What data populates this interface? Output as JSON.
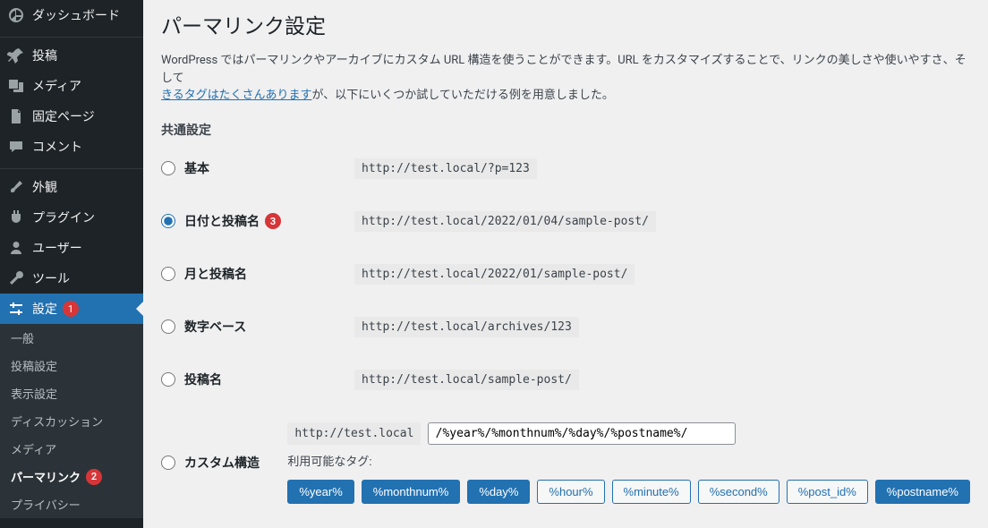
{
  "sidebar": {
    "dashboard": "ダッシュボード",
    "posts": "投稿",
    "media": "メディア",
    "pages": "固定ページ",
    "comments": "コメント",
    "appearance": "外観",
    "plugins": "プラグイン",
    "users": "ユーザー",
    "tools": "ツール",
    "settings": "設定",
    "settings_badge": "1",
    "sub": {
      "general": "一般",
      "writing": "投稿設定",
      "reading": "表示設定",
      "discussion": "ディスカッション",
      "media_s": "メディア",
      "permalinks": "パーマリンク",
      "permalinks_badge": "2",
      "privacy": "プライバシー"
    }
  },
  "page": {
    "title": "パーマリンク設定",
    "intro_1": "WordPress ではパーマリンクやアーカイブにカスタム URL 構造を使うことができます。URL をカスタマイズすることで、リンクの美しさや使いやすさ、そして",
    "intro_link": "きるタグはたくさんあります",
    "intro_2": "が、以下にいくつか試していただける例を用意しました。",
    "section": "共通設定"
  },
  "options": {
    "plain": {
      "label": "基本",
      "example": "http://test.local/?p=123"
    },
    "date_name": {
      "label": "日付と投稿名",
      "example": "http://test.local/2022/01/04/sample-post/",
      "badge": "3"
    },
    "month_name": {
      "label": "月と投稿名",
      "example": "http://test.local/2022/01/sample-post/"
    },
    "numeric": {
      "label": "数字ベース",
      "example": "http://test.local/archives/123"
    },
    "postname": {
      "label": "投稿名",
      "example": "http://test.local/sample-post/"
    },
    "custom": {
      "label": "カスタム構造",
      "prefix": "http://test.local",
      "value": "/%year%/%monthnum%/%day%/%postname%/"
    }
  },
  "tags": {
    "label": "利用可能なタグ:",
    "items": [
      "%year%",
      "%monthnum%",
      "%day%",
      "%hour%",
      "%minute%",
      "%second%",
      "%post_id%",
      "%postname%"
    ],
    "active": [
      "%year%",
      "%monthnum%",
      "%day%",
      "%postname%"
    ]
  }
}
